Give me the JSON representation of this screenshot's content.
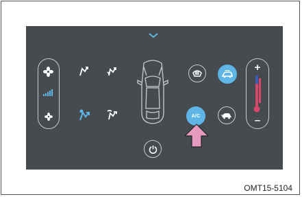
{
  "figure": {
    "code_label": "OMT15-5104"
  },
  "panel": {
    "ac_button_label": "A/C",
    "temp_up_label": "+",
    "temp_down_label": "–"
  },
  "colors": {
    "panel_bg": "#464b50",
    "accent_blue": "#5fb6e6",
    "pointer_pink": "#e79abf",
    "temp_red": "#d8466a",
    "temp_blue": "#3a5fb5"
  },
  "icons": {
    "top": "chevron-down-icon",
    "left_pill": [
      "fan-high-icon",
      "fan-level-bars-icon",
      "fan-low-icon"
    ],
    "airflow": [
      "airflow-face-icon",
      "airflow-face-feet-icon",
      "airflow-feet-icon",
      "airflow-feet-defrost-icon"
    ],
    "center": "car-top-view-icon",
    "right_buttons": [
      "front-defrost-icon",
      "recirculation-icon",
      "ac-button",
      "fresh-air-icon"
    ],
    "bottom": "power-icon",
    "pointer": "pointing-arrow-icon"
  },
  "state": {
    "recirculation_active": true,
    "ac_active": true,
    "active_airflow_mode": "airflow-face-feet"
  }
}
